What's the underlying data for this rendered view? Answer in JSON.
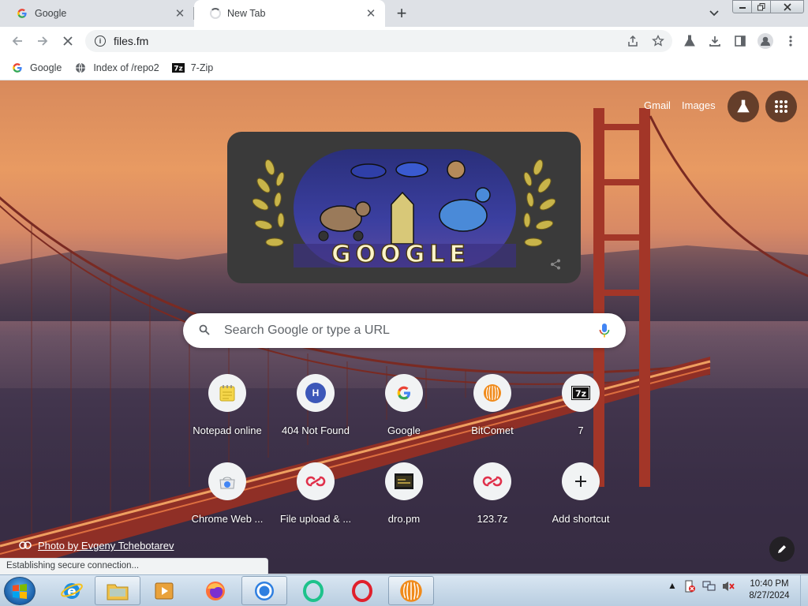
{
  "tabs": [
    {
      "title": "Google",
      "icon": "google-g-icon",
      "active": false
    },
    {
      "title": "New Tab",
      "icon": "loading-spinner-icon",
      "active": true
    }
  ],
  "toolbar": {
    "url": "files.fm"
  },
  "bookmarks": [
    {
      "label": "Google",
      "icon": "google-g-icon"
    },
    {
      "label": "Index of /repo2",
      "icon": "globe-icon"
    },
    {
      "label": "7-Zip",
      "icon": "7zip-icon"
    }
  ],
  "ntp": {
    "gmail_label": "Gmail",
    "images_label": "Images",
    "doodle_text": "GOOGLE",
    "search_placeholder": "Search Google or type a URL",
    "shortcuts": [
      {
        "label": "Notepad online",
        "icon": "notepad-icon"
      },
      {
        "label": "404 Not Found",
        "icon": "letter-h-icon",
        "letter": "H"
      },
      {
        "label": "Google",
        "icon": "google-g-icon"
      },
      {
        "label": "BitComet",
        "icon": "bitcomet-icon"
      },
      {
        "label": "7",
        "icon": "7zip-icon"
      },
      {
        "label": "Chrome Web ...",
        "icon": "chrome-web-store-icon"
      },
      {
        "label": "File upload & ...",
        "icon": "files-fm-icon"
      },
      {
        "label": "dro.pm",
        "icon": "dro-pm-icon"
      },
      {
        "label": "123.7z",
        "icon": "files-fm-icon"
      },
      {
        "label": "Add shortcut",
        "icon": "plus-icon"
      }
    ],
    "photo_credit": "Photo by Evgeny Tchebotarev"
  },
  "status": "Establishing secure connection...",
  "taskbar": {
    "items": [
      "start-orb",
      "internet-explorer-icon",
      "file-explorer-icon",
      "media-player-icon",
      "firefox-icon",
      "chrome-icon",
      "opera-icon-green",
      "opera-icon-red",
      "bitcomet-icon"
    ],
    "time": "10:40 PM",
    "date": "8/27/2024"
  },
  "colors": {
    "chrome_frame": "#dee1e6",
    "tab_active": "#ffffff",
    "omnibox": "#f1f3f4",
    "bridge_red": "#a83a2a",
    "doodle_bg": "#3a3a3a"
  }
}
